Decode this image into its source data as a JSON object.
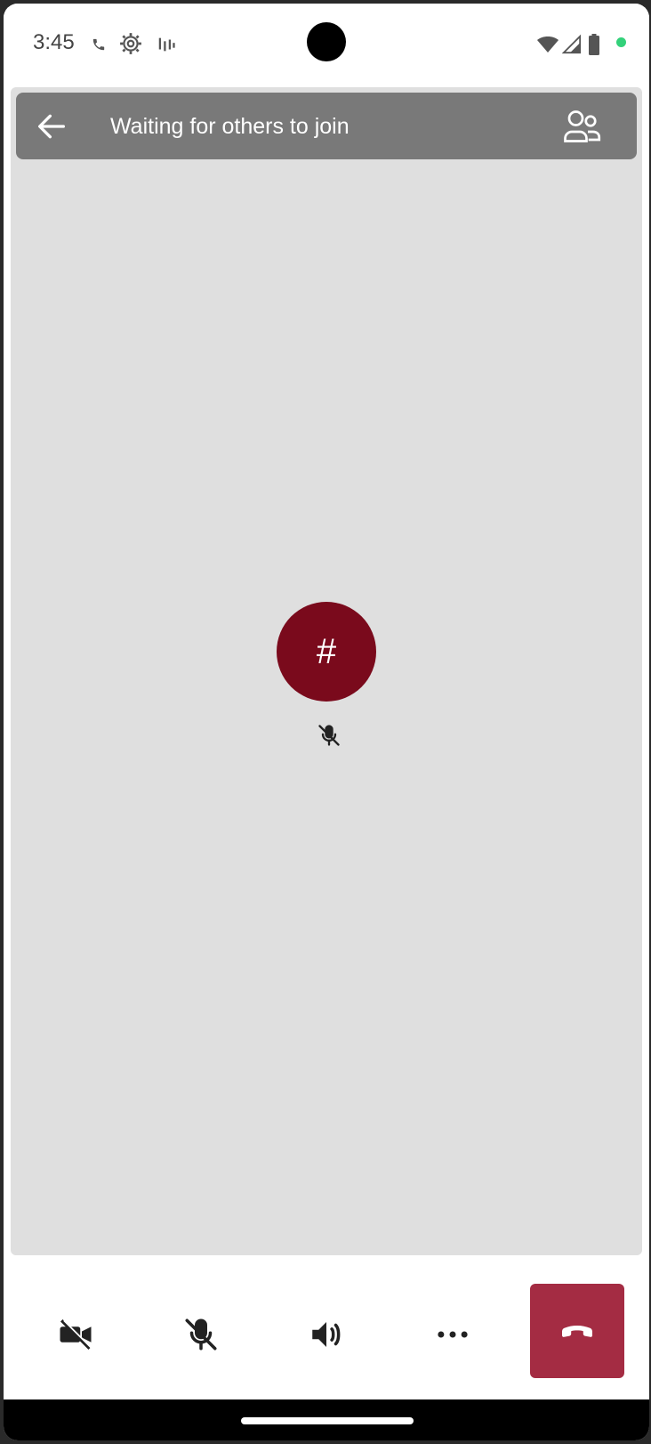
{
  "status_bar": {
    "time": "3:45",
    "icons": [
      "phone-icon",
      "settings-gear-icon",
      "signal-bars-icon",
      "wifi-icon",
      "cellular-icon",
      "battery-icon"
    ],
    "dot_color": "#33d17a"
  },
  "header": {
    "title": "Waiting for others to join",
    "back_icon": "arrow-left-icon",
    "participants_icon": "people-icon"
  },
  "participant": {
    "avatar_text": "#",
    "avatar_color": "#7a0a1c",
    "muted": true
  },
  "controls": {
    "buttons": [
      {
        "name": "camera-off-button",
        "icon": "video-off-icon"
      },
      {
        "name": "mic-off-button",
        "icon": "mic-off-icon"
      },
      {
        "name": "speaker-button",
        "icon": "speaker-icon"
      },
      {
        "name": "more-options-button",
        "icon": "more-icon"
      },
      {
        "name": "hang-up-button",
        "icon": "phone-hangup-icon"
      }
    ],
    "hangup_color": "#a42c43"
  }
}
